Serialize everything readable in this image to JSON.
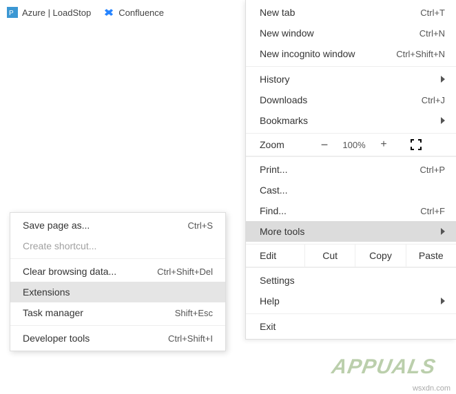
{
  "bookmarks": {
    "azure": "Azure | LoadStop",
    "confluence": "Confluence"
  },
  "menu": {
    "newTab": {
      "label": "New tab",
      "shortcut": "Ctrl+T"
    },
    "newWindow": {
      "label": "New window",
      "shortcut": "Ctrl+N"
    },
    "newIncognito": {
      "label": "New incognito window",
      "shortcut": "Ctrl+Shift+N"
    },
    "history": {
      "label": "History"
    },
    "downloads": {
      "label": "Downloads",
      "shortcut": "Ctrl+J"
    },
    "bookmarks": {
      "label": "Bookmarks"
    },
    "zoom": {
      "label": "Zoom",
      "value": "100%"
    },
    "print": {
      "label": "Print...",
      "shortcut": "Ctrl+P"
    },
    "cast": {
      "label": "Cast..."
    },
    "find": {
      "label": "Find...",
      "shortcut": "Ctrl+F"
    },
    "moreTools": {
      "label": "More tools"
    },
    "edit": {
      "label": "Edit",
      "cut": "Cut",
      "copy": "Copy",
      "paste": "Paste"
    },
    "settings": {
      "label": "Settings"
    },
    "help": {
      "label": "Help"
    },
    "exit": {
      "label": "Exit"
    }
  },
  "submenu": {
    "savePage": {
      "label": "Save page as...",
      "shortcut": "Ctrl+S"
    },
    "shortcut": {
      "label": "Create shortcut..."
    },
    "clearData": {
      "label": "Clear browsing data...",
      "shortcut": "Ctrl+Shift+Del"
    },
    "extensions": {
      "label": "Extensions"
    },
    "taskMgr": {
      "label": "Task manager",
      "shortcut": "Shift+Esc"
    },
    "devTools": {
      "label": "Developer tools",
      "shortcut": "Ctrl+Shift+I"
    }
  },
  "watermark": "APPUALS",
  "footer": "wsxdn.com"
}
